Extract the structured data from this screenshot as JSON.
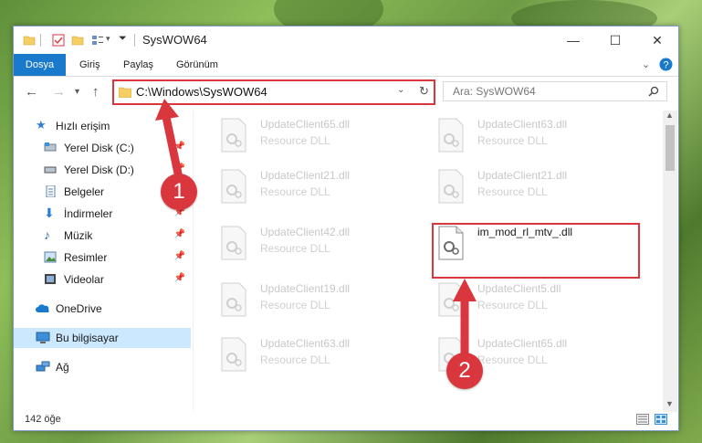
{
  "window": {
    "title": "SysWOW64",
    "minimize": "—",
    "maximize": "☐",
    "close": "✕"
  },
  "ribbon": {
    "tabs": [
      "Dosya",
      "Giriş",
      "Paylaş",
      "Görünüm"
    ]
  },
  "nav": {
    "back": "←",
    "forward": "→",
    "recent": "▾",
    "up": "↑",
    "address": "C:\\Windows\\SysWOW64",
    "search_placeholder": "Ara: SysWOW64"
  },
  "sidebar": {
    "items": [
      {
        "label": "Hızlı erişim",
        "icon": "star-icon",
        "pinned": false
      },
      {
        "label": "Yerel Disk (C:)",
        "icon": "drive-icon",
        "pinned": true
      },
      {
        "label": "Yerel Disk (D:)",
        "icon": "drive-icon",
        "pinned": true
      },
      {
        "label": "Belgeler",
        "icon": "document-icon",
        "pinned": true
      },
      {
        "label": "İndirmeler",
        "icon": "download-icon",
        "pinned": true
      },
      {
        "label": "Müzik",
        "icon": "music-icon",
        "pinned": true
      },
      {
        "label": "Resimler",
        "icon": "pictures-icon",
        "pinned": true
      },
      {
        "label": "Videolar",
        "icon": "video-icon",
        "pinned": true
      },
      {
        "label": "OneDrive",
        "icon": "cloud-icon",
        "pinned": false
      },
      {
        "label": "Bu bilgisayar",
        "icon": "computer-icon",
        "pinned": false
      },
      {
        "label": "Ağ",
        "icon": "network-icon",
        "pinned": false
      }
    ]
  },
  "files": [
    {
      "name": "UpdateClient65.dll",
      "type": "Resource DLL"
    },
    {
      "name": "UpdateClient63.dll",
      "type": "Resource DLL"
    },
    {
      "name": "UpdateClient21.dll",
      "type": "Resource DLL"
    },
    {
      "name": "UpdateClient21.dll",
      "type": "Resource DLL"
    },
    {
      "name": "UpdateClient42.dll",
      "type": "Resource DLL"
    },
    {
      "name": "im_mod_rl_mtv_.dll",
      "type": ""
    },
    {
      "name": "UpdateClient19.dll",
      "type": "Resource DLL"
    },
    {
      "name": "UpdateClient5.dll",
      "type": "Resource DLL"
    },
    {
      "name": "UpdateClient63.dll",
      "type": "Resource DLL"
    },
    {
      "name": "UpdateClient65.dll",
      "type": "Resource DLL"
    }
  ],
  "status": {
    "count": "142 öğe"
  },
  "callouts": [
    "1",
    "2"
  ],
  "colors": {
    "accent": "#1979ca",
    "highlight": "#d9363e",
    "selection": "#cce8ff"
  }
}
